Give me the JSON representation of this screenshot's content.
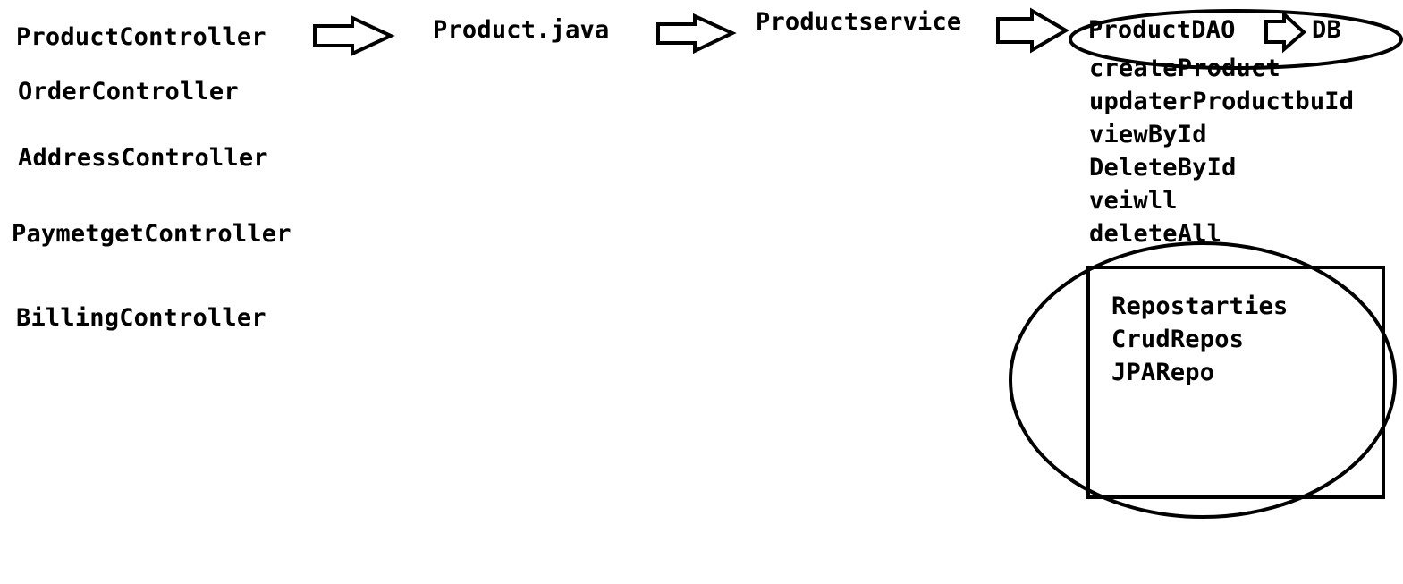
{
  "controllers": [
    "ProductController",
    "OrderController",
    "AddressController",
    "PaymetgetController",
    "BillingController"
  ],
  "flow": {
    "model": "Product.java",
    "service": "Productservice",
    "dao": "ProductDAO",
    "db": "DB"
  },
  "dao_methods": [
    "createProduct",
    "updaterProductbuId",
    "viewById",
    "DeleteById",
    "veiwll",
    "deleteAll"
  ],
  "repositories": [
    "Repostarties",
    "CrudRepos",
    "JPARepo"
  ]
}
